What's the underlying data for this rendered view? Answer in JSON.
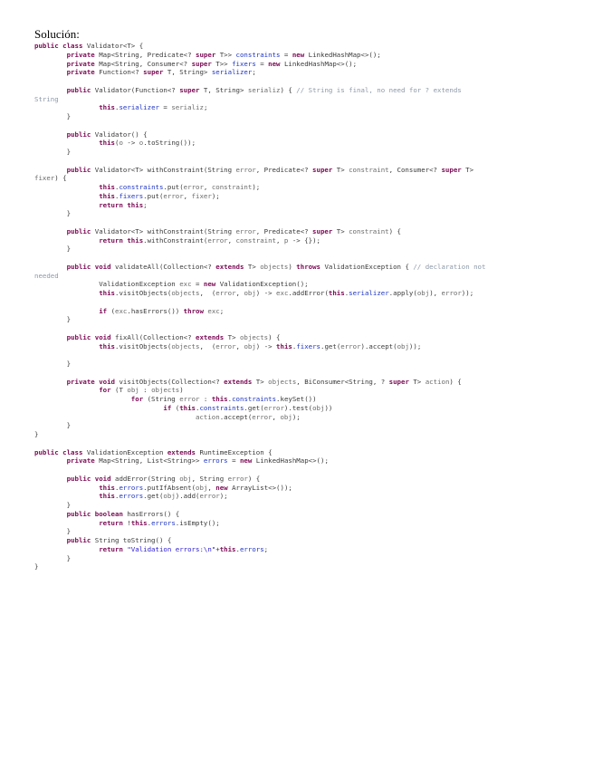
{
  "document": {
    "title": "Solución:",
    "colors": {
      "keyword": "#7b0a55",
      "field": "#1f36c2",
      "param": "#6a6a6a",
      "comment": "#8c98a8",
      "string": "#2a1bd0",
      "text": "#3a3a3a"
    },
    "code_lines": [
      [
        [
          "k",
          "public class "
        ],
        [
          "t",
          "Validator<T> {"
        ]
      ],
      [
        [
          "t",
          "        "
        ],
        [
          "k",
          "private "
        ],
        [
          "t",
          "Map<String, Predicate<? "
        ],
        [
          "k",
          "super "
        ],
        [
          "t",
          "T>> "
        ],
        [
          "f",
          "constraints"
        ],
        [
          "t",
          " = "
        ],
        [
          "k",
          "new "
        ],
        [
          "t",
          "LinkedHashMap<>();"
        ]
      ],
      [
        [
          "t",
          "        "
        ],
        [
          "k",
          "private "
        ],
        [
          "t",
          "Map<String, Consumer<? "
        ],
        [
          "k",
          "super "
        ],
        [
          "t",
          "T>> "
        ],
        [
          "f",
          "fixers"
        ],
        [
          "t",
          " = "
        ],
        [
          "k",
          "new "
        ],
        [
          "t",
          "LinkedHashMap<>();"
        ]
      ],
      [
        [
          "t",
          "        "
        ],
        [
          "k",
          "private "
        ],
        [
          "t",
          "Function<? "
        ],
        [
          "k",
          "super "
        ],
        [
          "t",
          "T, String> "
        ],
        [
          "f",
          "serializer"
        ],
        [
          "t",
          ";"
        ]
      ],
      [],
      [
        [
          "t",
          "        "
        ],
        [
          "k",
          "public "
        ],
        [
          "t",
          "Validator(Function<? "
        ],
        [
          "k",
          "super "
        ],
        [
          "t",
          "T, String> "
        ],
        [
          "p",
          "serializ"
        ],
        [
          "t",
          ") { "
        ],
        [
          "c",
          "// String is final, no need for ? extends"
        ]
      ],
      [
        [
          "c",
          "String"
        ]
      ],
      [
        [
          "t",
          "                "
        ],
        [
          "k",
          "this"
        ],
        [
          "t",
          "."
        ],
        [
          "f",
          "serializer"
        ],
        [
          "t",
          " = "
        ],
        [
          "p",
          "serializ"
        ],
        [
          "t",
          ";"
        ]
      ],
      [
        [
          "t",
          "        }"
        ]
      ],
      [],
      [
        [
          "t",
          "        "
        ],
        [
          "k",
          "public "
        ],
        [
          "t",
          "Validator() {"
        ]
      ],
      [
        [
          "t",
          "                "
        ],
        [
          "k",
          "this"
        ],
        [
          "t",
          "("
        ],
        [
          "p",
          "o"
        ],
        [
          "t",
          " -> "
        ],
        [
          "p",
          "o"
        ],
        [
          "t",
          ".toString());"
        ]
      ],
      [
        [
          "t",
          "        }"
        ]
      ],
      [],
      [
        [
          "t",
          "        "
        ],
        [
          "k",
          "public "
        ],
        [
          "t",
          "Validator<T> withConstraint(String "
        ],
        [
          "p",
          "error"
        ],
        [
          "t",
          ", Predicate<? "
        ],
        [
          "k",
          "super "
        ],
        [
          "t",
          "T> "
        ],
        [
          "p",
          "constraint"
        ],
        [
          "t",
          ", Consumer<? "
        ],
        [
          "k",
          "super "
        ],
        [
          "t",
          "T>"
        ]
      ],
      [
        [
          "p",
          "fixer"
        ],
        [
          "t",
          ") {"
        ]
      ],
      [
        [
          "t",
          "                "
        ],
        [
          "k",
          "this"
        ],
        [
          "t",
          "."
        ],
        [
          "f",
          "constraints"
        ],
        [
          "t",
          ".put("
        ],
        [
          "p",
          "error"
        ],
        [
          "t",
          ", "
        ],
        [
          "p",
          "constraint"
        ],
        [
          "t",
          ");"
        ]
      ],
      [
        [
          "t",
          "                "
        ],
        [
          "k",
          "this"
        ],
        [
          "t",
          "."
        ],
        [
          "f",
          "fixers"
        ],
        [
          "t",
          ".put("
        ],
        [
          "p",
          "error"
        ],
        [
          "t",
          ", "
        ],
        [
          "p",
          "fixer"
        ],
        [
          "t",
          ");"
        ]
      ],
      [
        [
          "t",
          "                "
        ],
        [
          "k",
          "return this"
        ],
        [
          "t",
          ";"
        ]
      ],
      [
        [
          "t",
          "        }"
        ]
      ],
      [],
      [
        [
          "t",
          "        "
        ],
        [
          "k",
          "public "
        ],
        [
          "t",
          "Validator<T> withConstraint(String "
        ],
        [
          "p",
          "error"
        ],
        [
          "t",
          ", Predicate<? "
        ],
        [
          "k",
          "super "
        ],
        [
          "t",
          "T> "
        ],
        [
          "p",
          "constraint"
        ],
        [
          "t",
          ") {"
        ]
      ],
      [
        [
          "t",
          "                "
        ],
        [
          "k",
          "return this"
        ],
        [
          "t",
          ".withConstraint("
        ],
        [
          "p",
          "error"
        ],
        [
          "t",
          ", "
        ],
        [
          "p",
          "constraint"
        ],
        [
          "t",
          ", "
        ],
        [
          "p",
          "p"
        ],
        [
          "t",
          " -> {});"
        ]
      ],
      [
        [
          "t",
          "        }"
        ]
      ],
      [],
      [
        [
          "t",
          "        "
        ],
        [
          "k",
          "public void "
        ],
        [
          "t",
          "validateAll(Collection<? "
        ],
        [
          "k",
          "extends "
        ],
        [
          "t",
          "T> "
        ],
        [
          "p",
          "objects"
        ],
        [
          "t",
          ") "
        ],
        [
          "k",
          "throws "
        ],
        [
          "t",
          "ValidationException { "
        ],
        [
          "c",
          "// declaration not"
        ]
      ],
      [
        [
          "c",
          "needed"
        ]
      ],
      [
        [
          "t",
          "                ValidationException "
        ],
        [
          "p",
          "exc"
        ],
        [
          "t",
          " = "
        ],
        [
          "k",
          "new "
        ],
        [
          "t",
          "ValidationException();"
        ]
      ],
      [
        [
          "t",
          "                "
        ],
        [
          "k",
          "this"
        ],
        [
          "t",
          ".visitObjects("
        ],
        [
          "p",
          "objects"
        ],
        [
          "t",
          ",  ("
        ],
        [
          "p",
          "error"
        ],
        [
          "t",
          ", "
        ],
        [
          "p",
          "obj"
        ],
        [
          "t",
          ") -> "
        ],
        [
          "p",
          "exc"
        ],
        [
          "t",
          ".addError("
        ],
        [
          "k",
          "this"
        ],
        [
          "t",
          "."
        ],
        [
          "f",
          "serializer"
        ],
        [
          "t",
          ".apply("
        ],
        [
          "p",
          "obj"
        ],
        [
          "t",
          "), "
        ],
        [
          "p",
          "error"
        ],
        [
          "t",
          "));"
        ]
      ],
      [],
      [
        [
          "t",
          "                "
        ],
        [
          "k",
          "if "
        ],
        [
          "t",
          "("
        ],
        [
          "p",
          "exc"
        ],
        [
          "t",
          ".hasErrors()) "
        ],
        [
          "k",
          "throw "
        ],
        [
          "p",
          "exc"
        ],
        [
          "t",
          ";"
        ]
      ],
      [
        [
          "t",
          "        }"
        ]
      ],
      [],
      [
        [
          "t",
          "        "
        ],
        [
          "k",
          "public void "
        ],
        [
          "t",
          "fixAll(Collection<? "
        ],
        [
          "k",
          "extends "
        ],
        [
          "t",
          "T> "
        ],
        [
          "p",
          "objects"
        ],
        [
          "t",
          ") {"
        ]
      ],
      [
        [
          "t",
          "                "
        ],
        [
          "k",
          "this"
        ],
        [
          "t",
          ".visitObjects("
        ],
        [
          "p",
          "objects"
        ],
        [
          "t",
          ",  ("
        ],
        [
          "p",
          "error"
        ],
        [
          "t",
          ", "
        ],
        [
          "p",
          "obj"
        ],
        [
          "t",
          ") -> "
        ],
        [
          "k",
          "this"
        ],
        [
          "t",
          "."
        ],
        [
          "f",
          "fixers"
        ],
        [
          "t",
          ".get("
        ],
        [
          "p",
          "error"
        ],
        [
          "t",
          ").accept("
        ],
        [
          "p",
          "obj"
        ],
        [
          "t",
          "));"
        ]
      ],
      [],
      [
        [
          "t",
          "        }"
        ]
      ],
      [],
      [
        [
          "t",
          "        "
        ],
        [
          "k",
          "private void "
        ],
        [
          "t",
          "visitObjects(Collection<? "
        ],
        [
          "k",
          "extends "
        ],
        [
          "t",
          "T> "
        ],
        [
          "p",
          "objects"
        ],
        [
          "t",
          ", BiConsumer<String, ? "
        ],
        [
          "k",
          "super "
        ],
        [
          "t",
          "T> "
        ],
        [
          "p",
          "action"
        ],
        [
          "t",
          ") {"
        ]
      ],
      [
        [
          "t",
          "                "
        ],
        [
          "k",
          "for "
        ],
        [
          "t",
          "(T "
        ],
        [
          "p",
          "obj"
        ],
        [
          "t",
          " : "
        ],
        [
          "p",
          "objects"
        ],
        [
          "t",
          ")"
        ]
      ],
      [
        [
          "t",
          "                        "
        ],
        [
          "k",
          "for "
        ],
        [
          "t",
          "(String "
        ],
        [
          "p",
          "error"
        ],
        [
          "t",
          " : "
        ],
        [
          "k",
          "this"
        ],
        [
          "t",
          "."
        ],
        [
          "f",
          "constraints"
        ],
        [
          "t",
          ".keySet())"
        ]
      ],
      [
        [
          "t",
          "                                "
        ],
        [
          "k",
          "if "
        ],
        [
          "t",
          "("
        ],
        [
          "k",
          "this"
        ],
        [
          "t",
          "."
        ],
        [
          "f",
          "constraints"
        ],
        [
          "t",
          ".get("
        ],
        [
          "p",
          "error"
        ],
        [
          "t",
          ").test("
        ],
        [
          "p",
          "obj"
        ],
        [
          "t",
          "))"
        ]
      ],
      [
        [
          "t",
          "                                        "
        ],
        [
          "p",
          "action"
        ],
        [
          "t",
          ".accept("
        ],
        [
          "p",
          "error"
        ],
        [
          "t",
          ", "
        ],
        [
          "p",
          "obj"
        ],
        [
          "t",
          ");"
        ]
      ],
      [
        [
          "t",
          "        }"
        ]
      ],
      [
        [
          "t",
          "}"
        ]
      ],
      [],
      [
        [
          "k",
          "public class "
        ],
        [
          "t",
          "ValidationException "
        ],
        [
          "k",
          "extends "
        ],
        [
          "t",
          "RuntimeException {"
        ]
      ],
      [
        [
          "t",
          "        "
        ],
        [
          "k",
          "private "
        ],
        [
          "t",
          "Map<String, List<String>> "
        ],
        [
          "f",
          "errors"
        ],
        [
          "t",
          " = "
        ],
        [
          "k",
          "new "
        ],
        [
          "t",
          "LinkedHashMap<>();"
        ]
      ],
      [],
      [
        [
          "t",
          "        "
        ],
        [
          "k",
          "public void "
        ],
        [
          "t",
          "addError(String "
        ],
        [
          "p",
          "obj"
        ],
        [
          "t",
          ", String "
        ],
        [
          "p",
          "error"
        ],
        [
          "t",
          ") {"
        ]
      ],
      [
        [
          "t",
          "                "
        ],
        [
          "k",
          "this"
        ],
        [
          "t",
          "."
        ],
        [
          "f",
          "errors"
        ],
        [
          "t",
          ".putIfAbsent("
        ],
        [
          "p",
          "obj"
        ],
        [
          "t",
          ", "
        ],
        [
          "k",
          "new "
        ],
        [
          "t",
          "ArrayList<>());"
        ]
      ],
      [
        [
          "t",
          "                "
        ],
        [
          "k",
          "this"
        ],
        [
          "t",
          "."
        ],
        [
          "f",
          "errors"
        ],
        [
          "t",
          ".get("
        ],
        [
          "p",
          "obj"
        ],
        [
          "t",
          ").add("
        ],
        [
          "p",
          "error"
        ],
        [
          "t",
          ");"
        ]
      ],
      [
        [
          "t",
          "        }"
        ]
      ],
      [
        [
          "t",
          "        "
        ],
        [
          "k",
          "public boolean "
        ],
        [
          "t",
          "hasErrors() {"
        ]
      ],
      [
        [
          "t",
          "                "
        ],
        [
          "k",
          "return "
        ],
        [
          "t",
          "!"
        ],
        [
          "k",
          "this"
        ],
        [
          "t",
          "."
        ],
        [
          "f",
          "errors"
        ],
        [
          "t",
          ".isEmpty();"
        ]
      ],
      [
        [
          "t",
          "        }"
        ]
      ],
      [
        [
          "t",
          "        "
        ],
        [
          "k",
          "public "
        ],
        [
          "t",
          "String toString() {"
        ]
      ],
      [
        [
          "t",
          "                "
        ],
        [
          "k",
          "return "
        ],
        [
          "s",
          "\"Validation errors:\\n\""
        ],
        [
          "t",
          "+"
        ],
        [
          "k",
          "this"
        ],
        [
          "t",
          "."
        ],
        [
          "f",
          "errors"
        ],
        [
          "t",
          ";"
        ]
      ],
      [
        [
          "t",
          "        }"
        ]
      ],
      [
        [
          "t",
          "}"
        ]
      ]
    ]
  }
}
